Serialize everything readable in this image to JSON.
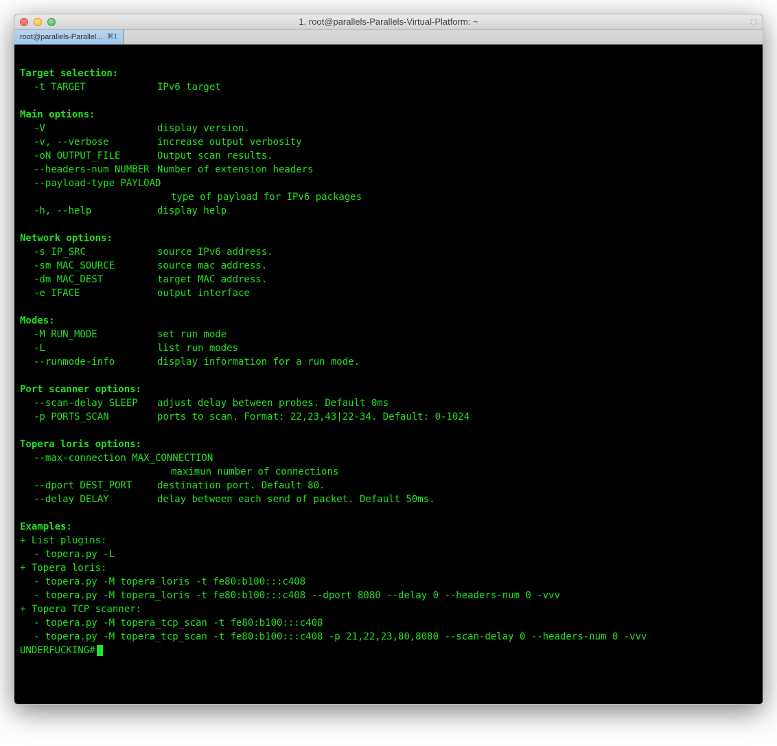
{
  "window": {
    "title": "1. root@parallels-Parallels-Virtual-Platform: ~"
  },
  "tab": {
    "label": "root@parallels-Parallel...",
    "hotkey": "⌘1"
  },
  "sections": {
    "target": {
      "header": "Target selection:",
      "items": [
        {
          "flag": "-t TARGET",
          "desc": "IPv6 target"
        }
      ]
    },
    "main": {
      "header": "Main options:",
      "items": [
        {
          "flag": "-V",
          "desc": "display version."
        },
        {
          "flag": "-v, --verbose",
          "desc": "increase output verbosity"
        },
        {
          "flag": "-oN OUTPUT_FILE",
          "desc": "Output scan results."
        },
        {
          "flag": "--headers-num NUMBER",
          "desc": "Number of extension headers"
        },
        {
          "flag": "--payload-type PAYLOAD",
          "desc": ""
        },
        {
          "flag": "",
          "desc": "type of payload for IPv6 packages"
        },
        {
          "flag": "-h, --help",
          "desc": "display help"
        }
      ]
    },
    "network": {
      "header": "Network options:",
      "items": [
        {
          "flag": "-s IP_SRC",
          "desc": "source IPv6 address."
        },
        {
          "flag": "-sm MAC_SOURCE",
          "desc": "source mac address."
        },
        {
          "flag": "-dm MAC_DEST",
          "desc": "target MAC address."
        },
        {
          "flag": "-e IFACE",
          "desc": "output interface"
        }
      ]
    },
    "modes": {
      "header": "Modes:",
      "items": [
        {
          "flag": "-M RUN_MODE",
          "desc": "set run mode"
        },
        {
          "flag": "-L",
          "desc": "list run modes"
        },
        {
          "flag": "--runmode-info",
          "desc": "display information for a run mode."
        }
      ]
    },
    "port": {
      "header": "Port scanner options:",
      "items": [
        {
          "flag": "--scan-delay SLEEP",
          "desc": "adjust delay between probes. Default 0ms"
        },
        {
          "flag": "-p PORTS_SCAN",
          "desc": "ports to scan. Format: 22,23,43|22-34. Default: 0-1024"
        }
      ]
    },
    "loris": {
      "header": "Topera loris options:",
      "items": [
        {
          "flag": "--max-connection MAX_CONNECTION",
          "desc": ""
        },
        {
          "flag": "",
          "desc": "maximun number of connections"
        },
        {
          "flag": "--dport DEST_PORT",
          "desc": "destination port. Default 80."
        },
        {
          "flag": "--delay DELAY",
          "desc": "delay between each send of packet. Default 50ms."
        }
      ]
    }
  },
  "examples": {
    "header": "Examples:",
    "groups": [
      {
        "title": "+ List plugins:",
        "cmds": [
          "- topera.py -L"
        ]
      },
      {
        "title": "+ Topera loris:",
        "cmds": [
          "- topera.py -M topera_loris -t fe80:b100:::c408",
          "- topera.py -M topera_loris -t fe80:b100:::c408 --dport 8080 --delay 0 --headers-num 0 -vvv"
        ]
      },
      {
        "title": "+ Topera TCP scanner:",
        "cmds": [
          "- topera.py -M topera_tcp_scan -t fe80:b100:::c408",
          "- topera.py -M topera_tcp_scan -t fe80:b100:::c408 -p 21,22,23,80,8080 --scan-delay 0 --headers-num 0 -vvv"
        ]
      }
    ]
  },
  "prompt": "UNDERFUCKING#"
}
